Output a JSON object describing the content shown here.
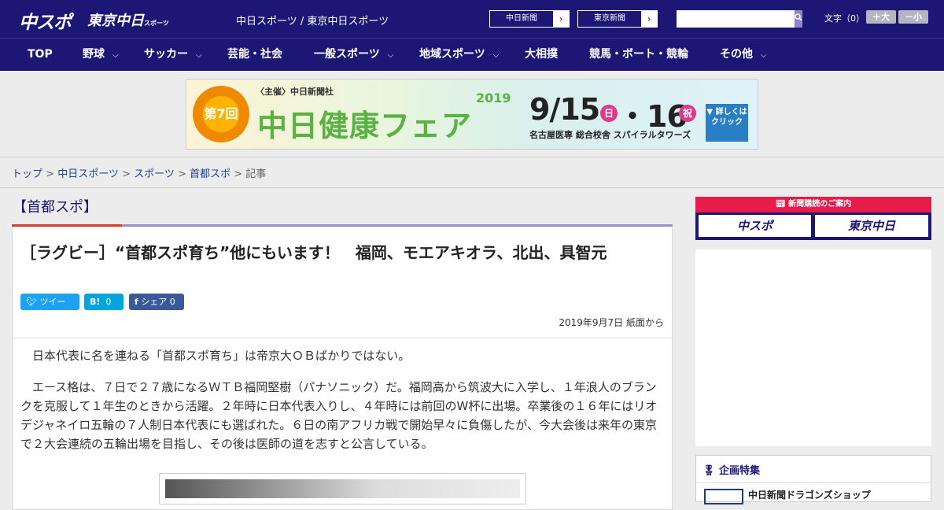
{
  "header": {
    "logo_chuspo": "中スポ",
    "logo_tokyo": "東京中日",
    "logo_tokyo_small": "スポーツ",
    "site_title": "中日スポーツ / 東京中日スポーツ",
    "paper_links": [
      {
        "label": "中日新聞"
      },
      {
        "label": "東京新聞"
      }
    ],
    "search_placeholder": "",
    "font_size_label": "文字（0）",
    "font_bigger": "＋大",
    "font_smaller": "－小"
  },
  "nav": {
    "items": [
      {
        "label": "TOP"
      },
      {
        "label": "野球"
      },
      {
        "label": "サッカー"
      },
      {
        "label": "芸能・社会"
      },
      {
        "label": "一般スポーツ"
      },
      {
        "label": "地域スポーツ"
      },
      {
        "label": "大相撲"
      },
      {
        "label": "競馬・ボート・競輪"
      },
      {
        "label": "その他"
      }
    ]
  },
  "banner": {
    "edition": "第7回",
    "organizer": "〈主催〉中日新聞社",
    "title": "中日健康フェア",
    "year": "2019",
    "dates": "9/15",
    "day1": "日",
    "dates2": "・16",
    "day2": "祝",
    "venue": "名古屋医専 総合校舎 スパイラルタワーズ",
    "cta": "▼ 詳しくは クリック"
  },
  "breadcrumb": {
    "items": [
      "トップ",
      "中日スポーツ",
      "スポーツ",
      "首都スポ"
    ],
    "current": "記事",
    "separator": " > "
  },
  "category": {
    "title": "【首都スポ】"
  },
  "article": {
    "headline": "［ラグビー］“首都スポ育ち”他にもいます！　福岡、モエアキオラ、北出、具智元",
    "share": {
      "tweet": "ツイート",
      "hatena_label": "B!",
      "hatena_count": "0",
      "facebook_label": "シェア",
      "facebook_count": "0"
    },
    "date": "2019年9月7日 紙面から",
    "paragraphs": [
      "　日本代表に名を連ねる「首都スポ育ち」は帝京大ＯＢばかりではない。",
      "　エース格は、７日で２７歳になるＷＴＢ福岡堅樹（パナソニック）だ。福岡高から筑波大に入学し、１年浪人のブランクを克服して１年生のときから活躍。２年時に日本代表入りし、４年時には前回のW杯に出場。卒業後の１６年にはリオデジャネイロ五輪の７人制日本代表にも選ばれた。６日の南アフリカ戦で開始早々に負傷したが、今大会後は来年の東京で２大会連続の五輪出場を目指し、その後は医師の道を志すと公言している。"
    ]
  },
  "sidebar": {
    "subscribe_header": "新聞購読のご案内",
    "subscribe_chuspo": "中スポ",
    "subscribe_tokyo": "東京中日",
    "feature_title": "企画特集",
    "feature_item": "中日新聞ドラゴンズショップ"
  },
  "colors": {
    "brand_navy": "#1c1775",
    "accent_red": "#d63a2a",
    "twitter": "#1da1f2",
    "hatena": "#00a4de",
    "facebook": "#3b5998"
  }
}
